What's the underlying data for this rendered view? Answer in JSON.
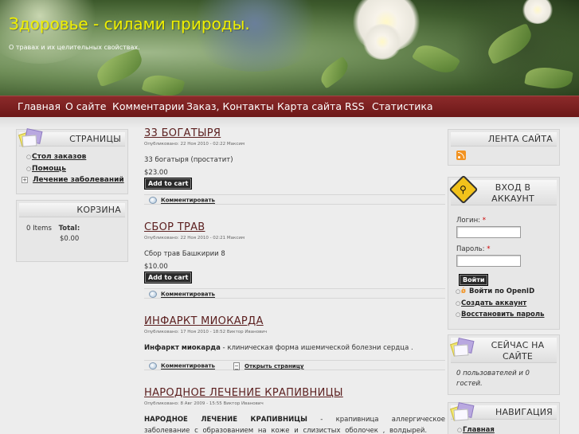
{
  "site": {
    "title": "Здоровье - силами природы.",
    "slogan": "О травах и их целительных свойствах."
  },
  "nav": [
    "Главная",
    "О сайте",
    "Комментарии",
    "Заказ, Контакты",
    "Карта сайта",
    "RSS",
    "Статистика"
  ],
  "left": {
    "pages": {
      "title": "СТРАНИЦЫ",
      "items": [
        "Стол заказов",
        "Помощь",
        "Лечение заболеваний"
      ]
    },
    "cart": {
      "title": "КОРЗИНА",
      "items_label": "0 Items",
      "total_label": "Total:",
      "total_value": "$0.00"
    }
  },
  "nodes": [
    {
      "title": "33 БОГАТЫРЯ",
      "meta": "Опубликовано: 22 Ноя 2010 - 02:22 Максим",
      "body": "33 богатыря (простатит)",
      "price": "$23.00",
      "button": "Add to cart",
      "comment": "Комментировать"
    },
    {
      "title": "СБОР ТРАВ",
      "meta": "Опубликовано: 22 Ноя 2010 - 02:21 Максим",
      "body": "Сбор трав Башкирии 8",
      "price": "$10.00",
      "button": "Add to cart",
      "comment": "Комментировать"
    },
    {
      "title": "ИНФАРКТ МИОКАРДА",
      "meta": "Опубликовано: 17 Ноя 2010 - 18:52 Виктор Иванович",
      "body_bold": "Инфаркт миокарда",
      "body_rest": " - клиническая форма ишемической болезни сердца .",
      "comment": "Комментировать",
      "open": "Открыть страницу"
    },
    {
      "title": "НАРОДНОЕ ЛЕЧЕНИЕ КРАПИВНИЦЫ",
      "meta": "Опубликовано: 8 Авг 2009 - 15:55 Виктор Иванович",
      "body_bold": "НАРОДНОЕ ЛЕЧЕНИЕ КРАПИВНИЦЫ",
      "body_rest": " - крапивница аллергическое заболевание с образованием на коже и слизистых оболочек , волдырей."
    }
  ],
  "right": {
    "feed": {
      "title": "ЛЕНТА САЙТА"
    },
    "login": {
      "title": "ВХОД В АККАУНТ",
      "username_label": "Логин:",
      "password_label": "Пароль:",
      "required": "*",
      "submit": "Войти",
      "links": [
        "Войти по OpenID",
        "Создать аккаунт",
        "Восстановить пароль"
      ]
    },
    "online": {
      "title": "СЕЙЧАС НА САЙТЕ",
      "text": "0 пользователей и 0 гостей."
    },
    "navigation": {
      "title": "НАВИГАЦИЯ",
      "items": [
        "Главная"
      ]
    }
  },
  "colors": {
    "nav_bg": "#7a1f1f",
    "title": "#f0f000",
    "node_title": "#5c2020"
  }
}
